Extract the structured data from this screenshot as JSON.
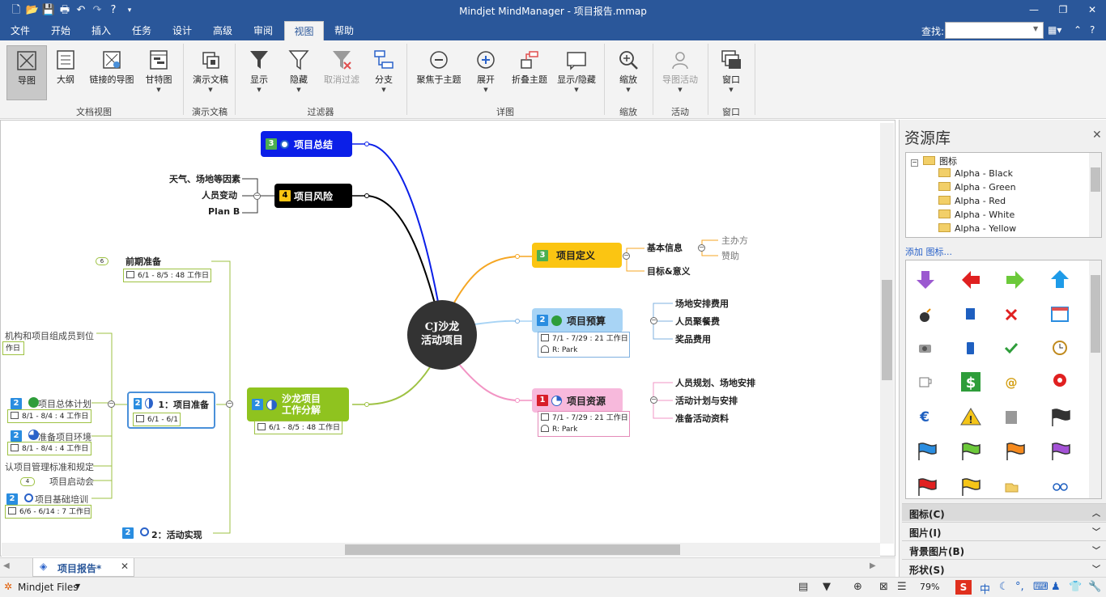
{
  "window": {
    "title": "Mindjet MindManager - 项目报告.mmap"
  },
  "menu": {
    "tabs": [
      "文件",
      "开始",
      "插入",
      "任务",
      "设计",
      "高级",
      "审阅",
      "视图",
      "帮助"
    ],
    "active": "视图",
    "search_label": "查找:",
    "search_value": ""
  },
  "ribbon": {
    "buttons": {
      "map": "导图",
      "outline": "大纲",
      "linked": "链接的导图",
      "gantt": "甘特图",
      "present": "演示文稿",
      "show": "显示",
      "hide": "隐藏",
      "cancel_filter": "取消过滤",
      "branch": "分支",
      "focus": "聚焦于主题",
      "expand": "展开",
      "collapse": "折叠主题",
      "showhide": "显示/隐藏",
      "zoom": "缩放",
      "activity": "导图活动",
      "window": "窗口"
    },
    "groups": {
      "docview": "文档视图",
      "present": "演示文稿",
      "filter": "过滤器",
      "detail": "详图",
      "zoom": "缩放",
      "activity": "活动",
      "window": "窗口"
    }
  },
  "map": {
    "central": {
      "line1": "CJ沙龙",
      "line2": "活动项目"
    },
    "summary": {
      "num": "3",
      "label": "项目总结"
    },
    "risk": {
      "num": "4",
      "label": "项目风险",
      "children": [
        "天气、场地等因素",
        "人员变动",
        "Plan B"
      ]
    },
    "definition": {
      "num": "3",
      "label": "项目定义",
      "children": [
        "基本信息",
        "目标&意义"
      ],
      "grandchildren": [
        "主办方",
        "赞助"
      ]
    },
    "budget": {
      "num": "2",
      "label": "项目预算",
      "date": "7/1 - 7/29 : 21 工作日",
      "resource": "R: Park",
      "children": [
        "场地安排费用",
        "人员聚餐费",
        "奖品费用"
      ]
    },
    "resources": {
      "num": "1",
      "label": "项目资源",
      "date": "7/1 - 7/29 : 21 工作日",
      "resource": "R: Park",
      "children": [
        "人员规划、场地安排",
        "活动计划与安排",
        "准备活动资料"
      ]
    },
    "breakdown": {
      "num": "2",
      "line1": "沙龙项目",
      "line2": "工作分解",
      "date": "6/1 - 8/5 : 48 工作日"
    },
    "prep_phase": {
      "badge": "6",
      "label": "前期准备",
      "date": "6/1 - 8/5 : 48 工作日"
    },
    "prep": {
      "num": "2",
      "label": "1：项目准备",
      "date": "6/1 - 6/1"
    },
    "left_items": {
      "org": "机构和项目组成员到位",
      "org_tail": "作日",
      "plan": "项目总体计划",
      "plan_date": "8/1 - 8/4 : 4 工作日",
      "env": "准备项目环境",
      "env_date": "8/1 - 8/4 : 4 工作日",
      "std": "认项目管理标准和规定",
      "kickoff_badge": "4",
      "kickoff": "项目启动会",
      "train": "项目基础培训",
      "train_date": "6/6 - 6/14 : 7 工作日"
    },
    "impl": {
      "num": "2",
      "label": "2：活动实现"
    }
  },
  "colors": {
    "titlebar": "#2a579a",
    "summary_fill": "#0b1fe8",
    "risk_fill": "#000000",
    "definition_fill": "#fbc512",
    "budget_fill": "#a8d4f5",
    "resources_fill": "#f7b9dc",
    "breakdown_fill": "#8fc31f"
  },
  "doc_tab": {
    "label": "项目报告*"
  },
  "status": {
    "files": "Mindjet Files",
    "zoom": "79%"
  },
  "resource_panel": {
    "title": "资源库",
    "tree_root": "图标",
    "tree_items": [
      "Alpha - Black",
      "Alpha - Green",
      "Alpha - Red",
      "Alpha - White",
      "Alpha - Yellow"
    ],
    "add_icon": "添加 图标...",
    "icons": [
      "arrow-down-purple",
      "arrow-left-red",
      "arrow-right-green",
      "arrow-up-blue",
      "bomb",
      "book",
      "cross-red",
      "calendar",
      "camera",
      "phone",
      "check-green",
      "clock",
      "coffee",
      "dollar",
      "at-sign",
      "alarm",
      "euro",
      "warning",
      "calculator",
      "flag-black",
      "flag-blue",
      "flag-green",
      "flag-orange",
      "flag-purple",
      "flag-red",
      "flag-yellow",
      "folder",
      "glasses"
    ],
    "sections": [
      {
        "label": "图标(C)",
        "selected": true
      },
      {
        "label": "图片(I)",
        "selected": false
      },
      {
        "label": "背景图片(B)",
        "selected": false
      },
      {
        "label": "形状(S)",
        "selected": false
      }
    ]
  }
}
